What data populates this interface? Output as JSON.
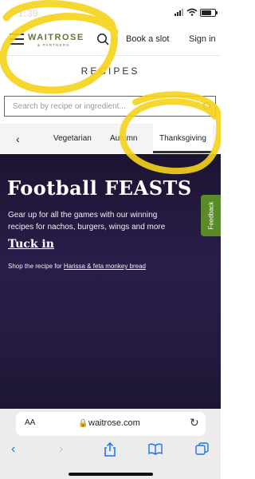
{
  "status_bar": {
    "time": "1:39"
  },
  "header": {
    "logo": {
      "name": "WAITROSE",
      "sub": "& PARTNERS"
    },
    "book_slot": "Book a slot",
    "sign_in": "Sign in"
  },
  "page": {
    "title": "RECIPES"
  },
  "search": {
    "placeholder": "Search by recipe or ingredient..."
  },
  "tabs": {
    "items": [
      "Vegetarian",
      "Autumn",
      "Thanksgiving"
    ],
    "active": "Thanksgiving"
  },
  "hero": {
    "title": "Football FEASTS",
    "text": "Gear up for all the games with our winning recipes for nachos, burgers, wings and more",
    "cta": "Tuck in",
    "shop_prefix": "Shop the recipe for",
    "shop_link": "Harissa & feta monkey bread"
  },
  "feedback": {
    "label": "Feedback"
  },
  "browser": {
    "aa": "AA",
    "url": "waitrose.com"
  },
  "colors": {
    "brand_green": "#5b7a2e",
    "hero_bg": "#241b3f",
    "feedback_tab": "#5a8a2a",
    "annotation_yellow": "#f5d31a",
    "ios_blue": "#1b73e8"
  }
}
